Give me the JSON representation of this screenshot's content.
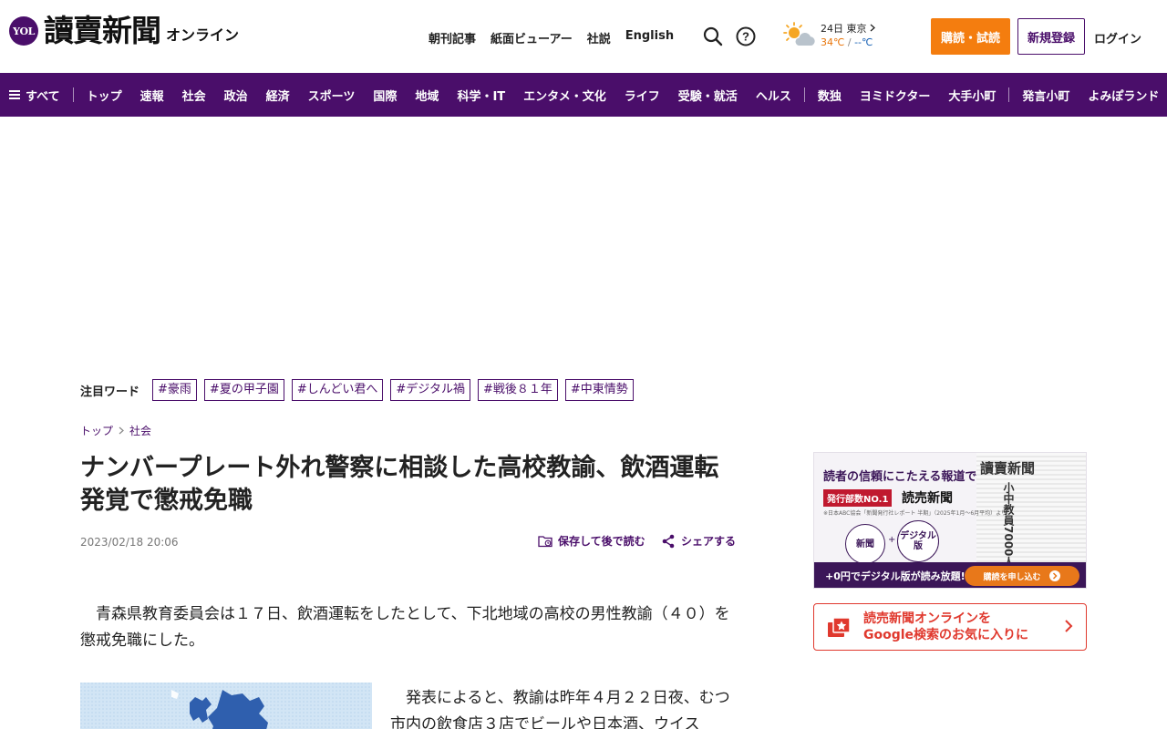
{
  "header": {
    "logo_badge": "YOL",
    "logo_title": "讀賣新聞",
    "logo_sub": "オンライン",
    "nav": [
      "朝刊記事",
      "紙面ビューアー",
      "社説",
      "English"
    ],
    "weather": {
      "date_place": "24日 東京",
      "high": "34℃",
      "divider": " / ",
      "low": "--℃"
    },
    "subscribe": "購読・試読",
    "register": "新規登録",
    "login": "ログイン"
  },
  "catnav": {
    "all": "すべて",
    "group1": [
      "トップ",
      "速報",
      "社会",
      "政治",
      "経済",
      "スポーツ",
      "国際",
      "地域",
      "科学・IT",
      "エンタメ・文化",
      "ライフ",
      "受験・就活",
      "ヘルス"
    ],
    "group2": [
      "数独",
      "ヨミドクター",
      "大手小町"
    ],
    "group3": [
      "発言小町",
      "よみぽランド"
    ]
  },
  "trending": {
    "label": "注目ワード",
    "tags": [
      "#豪雨",
      "#夏の甲子園",
      "#しんどい君へ",
      "#デジタル禍",
      "#戦後８１年",
      "#中東情勢"
    ]
  },
  "breadcrumb": [
    "トップ",
    "社会"
  ],
  "article": {
    "title": "ナンバープレート外れ警察に相談した高校教諭、飲酒運転発覚で懲戒免職",
    "date": "2023/02/18 20:06",
    "save": "保存して後で読む",
    "share": "シェアする",
    "lead": "　青森県教育委員会は１７日、飲酒運転をしたとして、下北地域の高校の男性教諭（４０）を懲戒免職にした。",
    "body2": "　発表によると、教諭は昨年４月２２日夜、むつ市内の飲食店３店でビールや日本酒、ウイス"
  },
  "sidebar": {
    "ad": {
      "headline": "読者の信頼にこたえる報道で",
      "badge": "発行部数NO.1",
      "brand": "読売新聞",
      "note": "※日本ABC協会「新聞発行社レポート 半期」（2025年1月〜6月平均）より",
      "circle1": "新聞",
      "plus": "+",
      "circle2": "デジタル版",
      "paper_title": "讀賣新聞",
      "paper_headline": "小中教員7000人増",
      "bottom": "+0円でデジタル版が読み放題!",
      "cta": "購読を申し込む"
    },
    "google": {
      "line1": "読売新聞オンラインを",
      "line2": "Google検索のお気に入りに"
    }
  },
  "colors": {
    "brand_purple": "#4a0e6a",
    "subscribe_orange": "#f47d0f",
    "google_red": "#e0392e"
  }
}
